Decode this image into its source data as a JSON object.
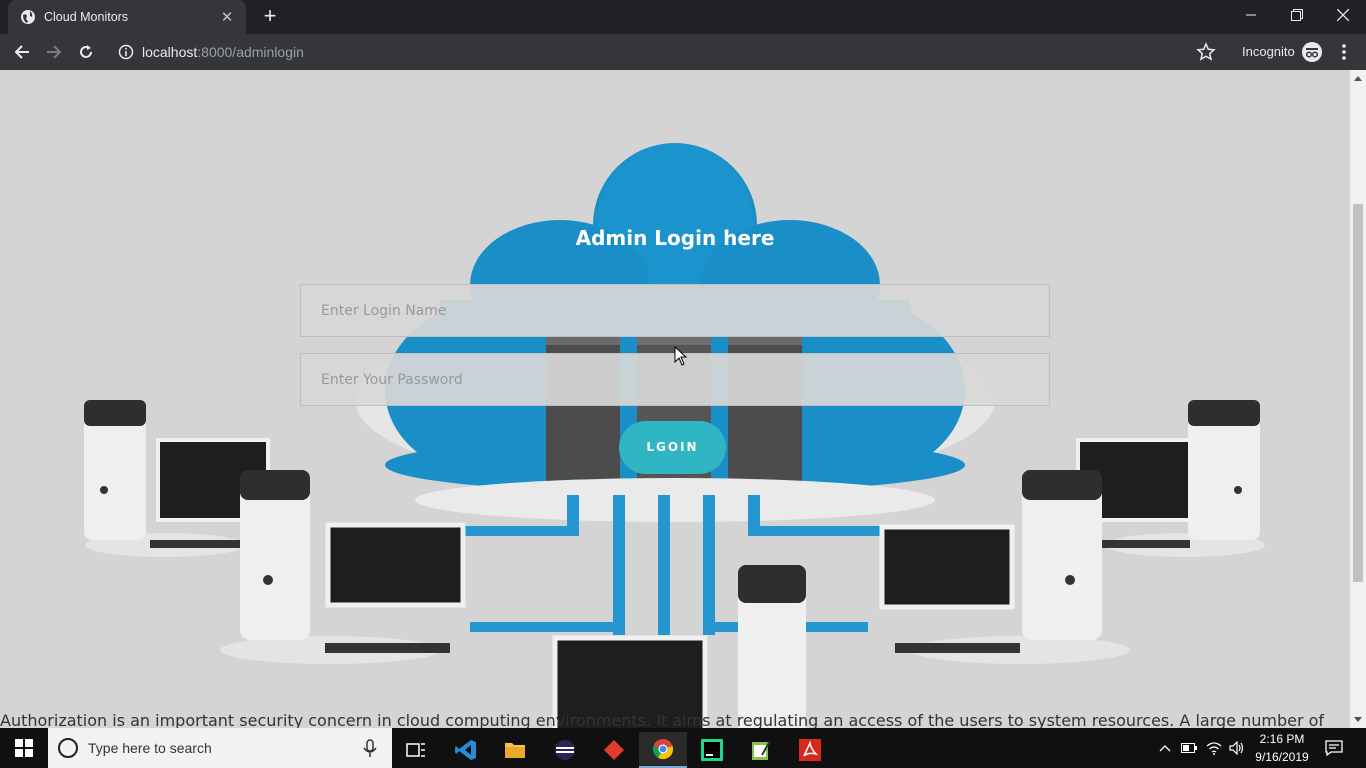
{
  "browser": {
    "tab_title": "Cloud Monitors",
    "url_host": "localhost",
    "url_path": ":8000/adminlogin",
    "incognito_label": "Incognito"
  },
  "page": {
    "heading": "Admin Login here",
    "login_name_placeholder": "Enter Login Name",
    "password_placeholder": "Enter Your Password",
    "login_button": "LGOIN",
    "footer_text": "Authorization is an important security concern in cloud computing environments. It aims at regulating an access of the users to system resources. A large number of"
  },
  "taskbar": {
    "search_placeholder": "Type here to search",
    "time": "2:16 PM",
    "date": "9/16/2019"
  },
  "colors": {
    "cloud_blue": "#1a8fc7",
    "button_teal": "#2fb5c4",
    "page_bg": "#d4d4d4"
  }
}
